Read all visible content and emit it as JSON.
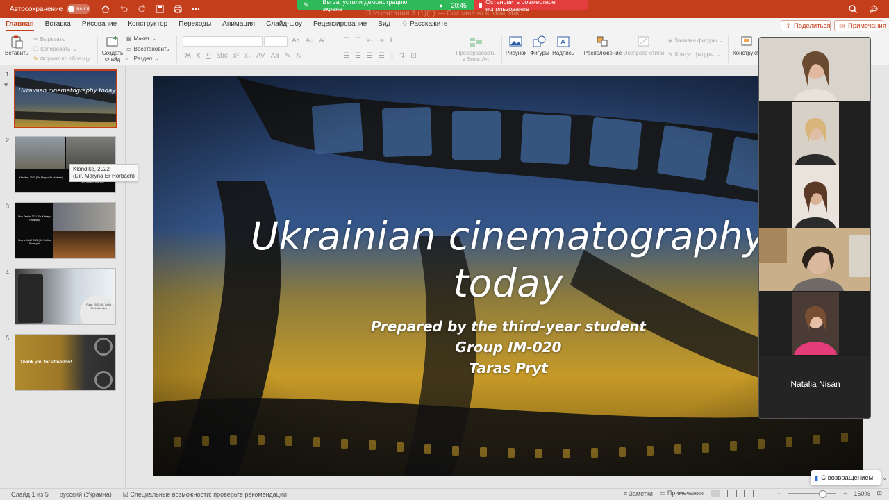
{
  "titlebar": {
    "autosave_label": "Автосохранение",
    "toggle_label": "ВЫКЛ.",
    "doc_title_faded": "Презентация 3 (1)(1) — Сохранено в Мой Mac"
  },
  "share_banner": {
    "message": "Вы запустили демонстрацию экрана",
    "time": "20:45",
    "stop_label": "Остановить совместное использование"
  },
  "tabs": [
    {
      "label": "Главная"
    },
    {
      "label": "Вставка"
    },
    {
      "label": "Рисование"
    },
    {
      "label": "Конструктор"
    },
    {
      "label": "Переходы"
    },
    {
      "label": "Анимация"
    },
    {
      "label": "Слайд-шоу"
    },
    {
      "label": "Рецензирование"
    },
    {
      "label": "Вид"
    },
    {
      "label": "Расскажите"
    }
  ],
  "share_button": "Поделиться",
  "comments_button": "Примечания",
  "ribbon": {
    "paste": "Вставить",
    "cut": "Вырезать",
    "copy": "Копировать",
    "format_painter": "Формат по образцу",
    "new_slide": "Создать слайд",
    "layout": "Макет",
    "reset": "Восстановить",
    "section": "Раздел",
    "smartart": "Преобразовать в SmartArt",
    "picture": "Рисунок",
    "shapes": "Фигуры",
    "textbox": "Надпись",
    "arrange": "Расположение",
    "quick_styles": "Экспресс-стили",
    "shape_fill": "Заливка фигуры",
    "shape_outline": "Контур фигуры",
    "designer": "Конструктор"
  },
  "thumbnails": [
    {
      "number": "1",
      "title": "Ukrainian cinematography today"
    },
    {
      "number": "2",
      "caption_left": "Klondike, 2022 (Dir. Maryna Er Horbach)",
      "caption_right": "(Dir. Mariam Buchen)"
    },
    {
      "number": "3",
      "caption_top": "Stop-Zemlia, 2021 (Dir. Kateryna Hornostai)",
      "caption_bottom": "How is Katia? 2022 (Dir. Kristina Tynkevych)"
    },
    {
      "number": "4",
      "caption": "Pulse, 2022 (Dir. Sofiia Chebotarenko)"
    },
    {
      "number": "5",
      "title": "Thank you for attention!"
    }
  ],
  "tooltip": {
    "line1": "Klondike, 2022",
    "line2": "(Dir. Maryna Er Horbach)"
  },
  "slide": {
    "title_line1": "Ukrainian cinematography",
    "title_line2": "today",
    "sub_line1": "Prepared by the third-year student",
    "sub_line2": "Group IM-020",
    "sub_line3": "Taras Pryt"
  },
  "participants": [
    {
      "name": ""
    },
    {
      "name": ""
    },
    {
      "name": ""
    },
    {
      "name": ""
    },
    {
      "name": ""
    },
    {
      "name": "Natalia Nisan"
    }
  ],
  "back_button": "С возвращением!",
  "status": {
    "slide_counter": "Слайд 1 из 5",
    "language": "русский (Украина)",
    "accessibility": "Специальные возможности: проверьте рекомендации",
    "notes": "Заметки",
    "comments": "Примечания",
    "zoom": "160%"
  },
  "colors": {
    "accent": "#c43e1c",
    "share_green": "#2fb95a",
    "share_red": "#e43d3d"
  }
}
